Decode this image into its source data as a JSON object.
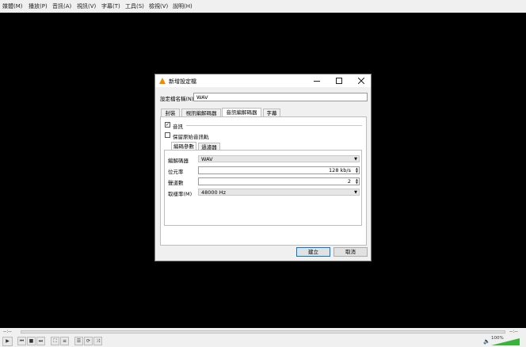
{
  "menu": [
    "媒體(M)",
    "播放(P)",
    "音訊(A)",
    "視訊(V)",
    "字幕(T)",
    "工具(S)",
    "檢視(V)",
    "說明(H)"
  ],
  "dialog": {
    "title": "新增設定檔",
    "profile_label": "設定檔名稱(N)",
    "profile_value": "WAV",
    "tabs": [
      "封裝",
      "視訊編解碼器",
      "音訊編解碼器",
      "字幕"
    ],
    "active_tab": "音訊編解碼器",
    "audio_label": "音訊",
    "audio_checked": true,
    "keep_label": "保留原始音訊軌",
    "keep_checked": false,
    "subtabs": [
      "編碼參數",
      "過濾器"
    ],
    "codec_label": "編解碼器",
    "codec_value": "WAV",
    "bitrate_label": "位元率",
    "bitrate_value": "128 kb/s",
    "channels_label": "聲道數",
    "channels_value": "2",
    "samplerate_label": "取樣率(M)",
    "samplerate_value": "48000 Hz",
    "create_label": "建立",
    "cancel_label": "取消"
  },
  "player": {
    "time_elapsed": "--:--",
    "time_total": "--:--",
    "volume_text": "100%",
    "volume_level": 1.0
  }
}
